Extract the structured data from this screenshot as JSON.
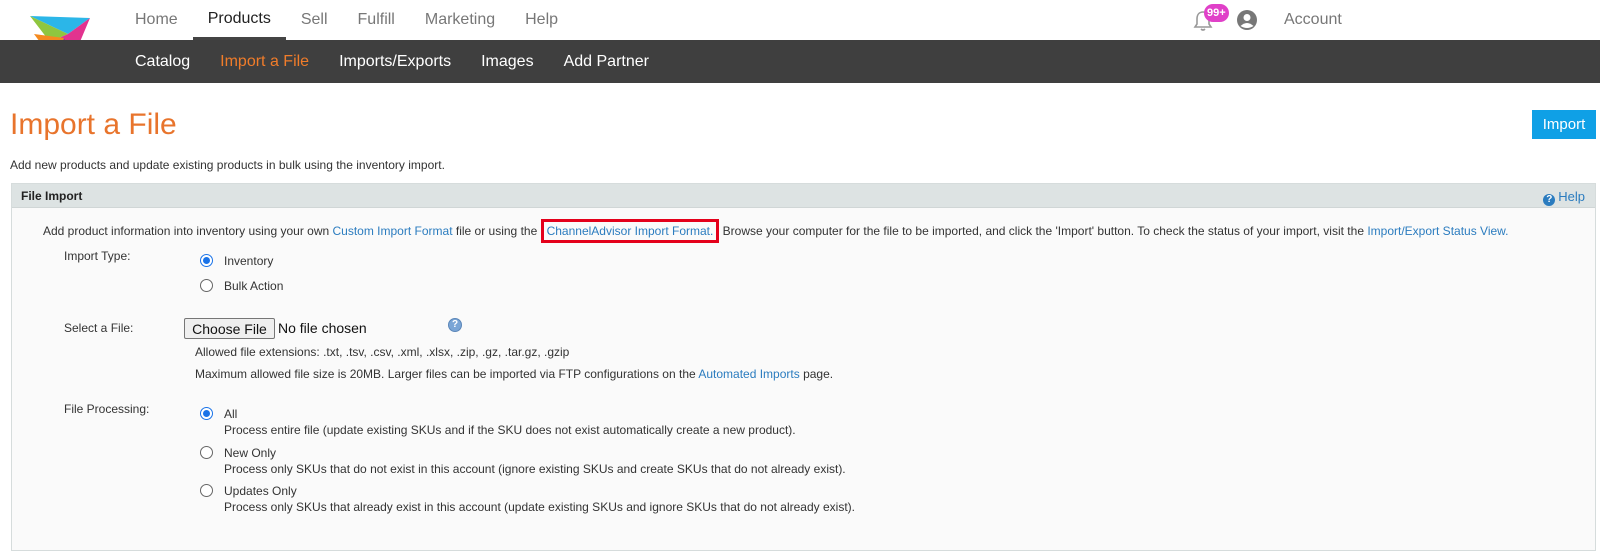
{
  "top_nav": {
    "items": [
      "Home",
      "Products",
      "Sell",
      "Fulfill",
      "Marketing",
      "Help"
    ],
    "active": "Products",
    "notification_badge": "99+",
    "account_label": "Account"
  },
  "sub_nav": {
    "items": [
      "Catalog",
      "Import a File",
      "Imports/Exports",
      "Images",
      "Add Partner"
    ],
    "active": "Import a File"
  },
  "page": {
    "title": "Import a File",
    "import_button": "Import",
    "subtitle": "Add new products and update existing products in bulk using the inventory import."
  },
  "panel": {
    "title": "File Import",
    "help_label": "Help",
    "intro_part1": "Add product information into inventory using your own ",
    "intro_link1": "Custom Import Format",
    "intro_part2": " file or using the ",
    "intro_link2": "ChannelAdvisor Import Format.",
    "intro_part3": " Browse your computer for the file to be imported, and click the 'Import' button. To check the status of your import, visit the ",
    "intro_link3": "Import/Export Status View.",
    "import_type_label": "Import Type:",
    "import_type_options": [
      {
        "label": "Inventory",
        "checked": true
      },
      {
        "label": "Bulk Action",
        "checked": false
      }
    ],
    "select_file_label": "Select a File:",
    "choose_file_button": "Choose File",
    "no_file_text": "No file chosen",
    "allowed_extensions": "Allowed file extensions: .txt, .tsv, .csv, .xml, .xlsx, .zip, .gz, .tar.gz, .gzip",
    "max_size_part1": "Maximum allowed file size is 20MB. Larger files can be imported via FTP configurations on the ",
    "max_size_link": "Automated Imports",
    "max_size_part2": " page.",
    "file_processing_label": "File Processing:",
    "file_processing_options": [
      {
        "label": "All",
        "desc": "Process entire file (update existing SKUs and if the SKU does not exist automatically create a new product).",
        "checked": true
      },
      {
        "label": "New Only",
        "desc": "Process only SKUs that do not exist in this account (ignore existing SKUs and create SKUs that do not already exist).",
        "checked": false
      },
      {
        "label": "Updates Only",
        "desc": "Process only SKUs that already exist in this account (update existing SKUs and ignore SKUs that do not already exist).",
        "checked": false
      }
    ]
  },
  "colors": {
    "accent_orange": "#e8742c",
    "link_blue": "#2b7cbf",
    "import_button": "#0fa0e6",
    "subnav_bg": "#3f3f3f",
    "highlight_box": "#e4001b"
  }
}
